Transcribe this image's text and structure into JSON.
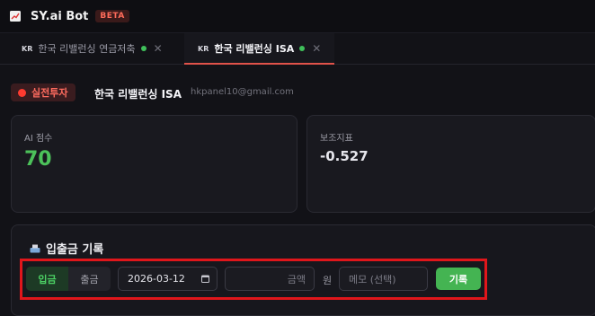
{
  "app": {
    "title": "SY.ai Bot",
    "badge": "BETA"
  },
  "tabs": [
    {
      "flag": "KR",
      "label": "한국 리밸런싱 연금저축",
      "active": false
    },
    {
      "flag": "KR",
      "label": "한국 리밸런싱 ISA",
      "active": true
    }
  ],
  "account": {
    "mode": "실전투자",
    "name": "한국 리밸런싱 ISA",
    "email": "hkpanel10@gmail.com"
  },
  "cards": {
    "ai_score": {
      "label": "AI 점수",
      "value": "70"
    },
    "indicator": {
      "label": "보조지표",
      "value": "-0.527"
    }
  },
  "record": {
    "title": "입출금 기록",
    "deposit_label": "입금",
    "withdraw_label": "출금",
    "date_value": "2026-03-12",
    "amount_placeholder": "금액",
    "unit": "원",
    "memo_placeholder": "메모 (선택)",
    "submit_label": "기록"
  },
  "colors": {
    "accent_green": "#4cc15a",
    "live_red": "#ff3b30",
    "highlight": "#e0161b",
    "tab_underline": "#e0524a"
  }
}
